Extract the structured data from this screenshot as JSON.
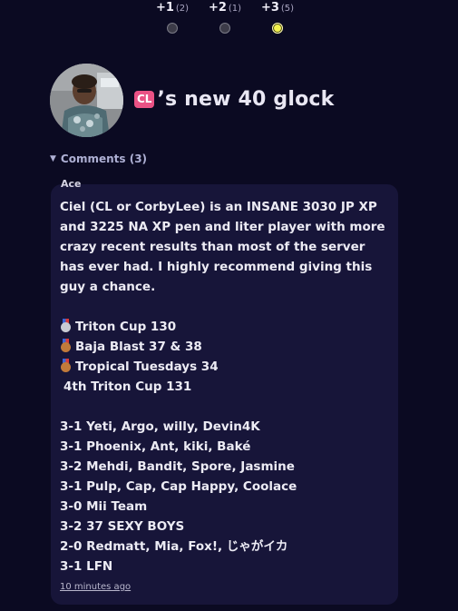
{
  "votes": [
    {
      "label": "+1",
      "count": "(2)",
      "selected": false
    },
    {
      "label": "+2",
      "count": "(1)",
      "selected": false
    },
    {
      "label": "+3",
      "count": "(5)",
      "selected": true
    }
  ],
  "header": {
    "badge": "CL",
    "title": "’s new 40 glock"
  },
  "comments": {
    "toggle_label": "Comments (3)",
    "items": [
      {
        "author": "Ace",
        "intro": "Ciel (CL or CorbyLee) is an INSANE 3030 JP XP and 3225 NA XP pen and liter player with more crazy recent results than most of the server has ever had. I highly recommend giving this guy a chance.",
        "placements": [
          {
            "medal": "silver",
            "text": "Triton Cup 130"
          },
          {
            "medal": "bronze",
            "text": "Baja Blast 37 & 38"
          },
          {
            "medal": "bronze",
            "text": "Tropical Tuesdays 34"
          },
          {
            "medal": "",
            "text": "4th Triton Cup 131"
          }
        ],
        "results": [
          "3-1 Yeti, Argo, willy, Devin4K",
          "3-1 Phoenix, Ant, kiki, Baké",
          "3-2 Mehdi, Bandit, Spore, Jasmine",
          "3-1 Pulp, Cap, Cap Happy, Coolace",
          "3-0 Mii Team",
          "3-2 37 SEXY BOYS",
          "2-0 Redmatt, Mia, Fox!, じゃがイカ",
          "3-1 LFN"
        ],
        "timestamp": "10 minutes ago"
      }
    ]
  },
  "colors": {
    "background": "#0b0a22",
    "card": "#171539",
    "badge": "#ea5285",
    "selected_dot": "#f4f24e"
  },
  "icons": {
    "medal_silver": "second-place-medal-icon",
    "medal_bronze": "third-place-medal-icon",
    "caret": "caret-down-icon"
  }
}
